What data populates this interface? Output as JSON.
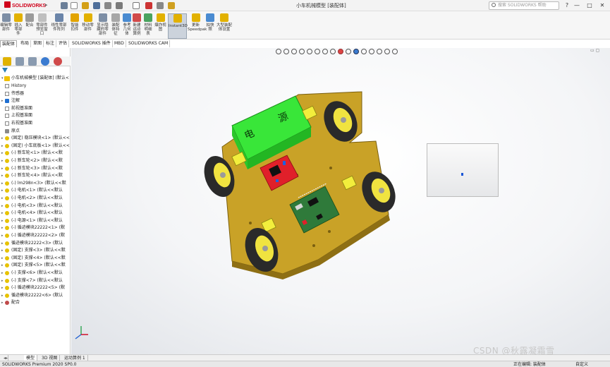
{
  "app": {
    "logo": "SOLIDWORKS",
    "doc_title": "小车机械模型 [装配体]",
    "search_placeholder": "搜索 SOLIDWORKS 帮助",
    "window_buttons": [
      "?",
      "—",
      "□",
      "✕"
    ]
  },
  "ribbon": {
    "buttons": [
      {
        "label": "编辑零部件",
        "color": "#7d8ea5"
      },
      {
        "label": "插入零部件",
        "color": "#e2b100"
      },
      {
        "label": "配合",
        "color": "#9b9b9b"
      },
      {
        "label": "零部件预览窗口",
        "color": "#bfbfbf"
      },
      {
        "label": "线性零部件阵列",
        "color": "#6b85a9"
      },
      {
        "label": "智能扣件",
        "color": "#e2a400"
      },
      {
        "label": "移动零部件",
        "color": "#e2b100"
      },
      {
        "label": "显示隐藏的零部件",
        "color": "#7d8ea5"
      },
      {
        "label": "装配体特征",
        "color": "#a7a7a7"
      },
      {
        "label": "参考几何体",
        "color": "#4a8bd1"
      },
      {
        "label": "新建运动算例",
        "color": "#d14a4a"
      },
      {
        "label": "材料明细表",
        "color": "#4aa35f"
      },
      {
        "label": "爆炸视图",
        "color": "#e2b100"
      },
      {
        "label": "Instant3D",
        "color": "#e2b100"
      },
      {
        "label": "更新 Speedpak",
        "color": "#e2b100"
      },
      {
        "label": "拍快照",
        "color": "#4a8bd1"
      },
      {
        "label": "大型装配体设置",
        "color": "#e2b100"
      }
    ]
  },
  "command_tabs": [
    "装配体",
    "布局",
    "草图",
    "标注",
    "评估",
    "SOLIDWORKS 插件",
    "MBD",
    "SOLIDWORKS CAM"
  ],
  "tree": {
    "root": "小车机械模型 [装配体] (默认<",
    "items": [
      {
        "label": "History",
        "icon": "history-icon",
        "kind": "doc"
      },
      {
        "label": "传感器",
        "icon": "sensor-icon",
        "kind": "doc"
      },
      {
        "label": "注解",
        "icon": "annotation-icon",
        "kind": "blue"
      },
      {
        "label": "前视基准面",
        "icon": "plane-icon",
        "kind": "doc"
      },
      {
        "label": "上视基准面",
        "icon": "plane-icon",
        "kind": "doc"
      },
      {
        "label": "右视基准面",
        "icon": "plane-icon",
        "kind": "doc"
      },
      {
        "label": "原点",
        "icon": "origin-icon",
        "kind": "gray"
      },
      {
        "label": "(固定) 稳压模块<1> (默认<<",
        "icon": "part-icon",
        "kind": "part"
      },
      {
        "label": "(固定) 小车底板<1> (默认<<",
        "icon": "part-icon",
        "kind": "part"
      },
      {
        "label": "(-) 新车轮<1> (默认<<默",
        "icon": "part-icon",
        "kind": "part"
      },
      {
        "label": "(-) 新车轮<2> (默认<<默",
        "icon": "part-icon",
        "kind": "part"
      },
      {
        "label": "(-) 新车轮<3> (默认<<默",
        "icon": "part-icon",
        "kind": "part"
      },
      {
        "label": "(-) 新车轮<4> (默认<<默",
        "icon": "part-icon",
        "kind": "part"
      },
      {
        "label": "(-) lm298n<3> (默认<<默",
        "icon": "part-icon",
        "kind": "part"
      },
      {
        "label": "(-) 电机<1> (默认<<默认",
        "icon": "part-icon",
        "kind": "part"
      },
      {
        "label": "(-) 电机<2> (默认<<默认",
        "icon": "part-icon",
        "kind": "part"
      },
      {
        "label": "(-) 电机<3> (默认<<默认",
        "icon": "part-icon",
        "kind": "part"
      },
      {
        "label": "(-) 电机<4> (默认<<默认",
        "icon": "part-icon",
        "kind": "part"
      },
      {
        "label": "(-) 电源<1> (默认<<默认",
        "icon": "part-icon",
        "kind": "part"
      },
      {
        "label": "(-) 循迹模块22222<1> (默",
        "icon": "part-icon",
        "kind": "part"
      },
      {
        "label": "(-) 循迹模块22222<2> (默",
        "icon": "part-icon",
        "kind": "part"
      },
      {
        "label": "循迹模块22222<3> (默认",
        "icon": "part-icon",
        "kind": "part"
      },
      {
        "label": "(固定) 支撑<3> (默认<<默",
        "icon": "part-icon",
        "kind": "part"
      },
      {
        "label": "(固定) 支撑<4> (默认<<默",
        "icon": "part-icon",
        "kind": "part"
      },
      {
        "label": "(固定) 支撑<5> (默认<<默",
        "icon": "part-icon",
        "kind": "part"
      },
      {
        "label": "(-) 支撑<6> (默认<<默认",
        "icon": "part-icon",
        "kind": "part"
      },
      {
        "label": "(-) 支撑<7> (默认<<默认",
        "icon": "part-icon",
        "kind": "part"
      },
      {
        "label": "(-) 循迹模块22222<5> (默",
        "icon": "part-icon",
        "kind": "part"
      },
      {
        "label": "循迹模块22222<6> (默认",
        "icon": "part-icon",
        "kind": "part"
      },
      {
        "label": "配合",
        "icon": "mate-icon",
        "kind": "mate"
      }
    ]
  },
  "model": {
    "battery_label_1": "电",
    "battery_label_2": "源"
  },
  "bottom_tabs": [
    "模型",
    "3D 视图",
    "运动算例 1"
  ],
  "status": {
    "left": "SOLIDWORKS Premium 2020 SP0.0",
    "right_items": [
      "正在编辑: 装配体",
      "自定义"
    ]
  },
  "watermark": "CSDN @秋露凝霜雪",
  "colors": {
    "body_yellow": "#c9a227",
    "battery_green": "#39e639",
    "driver_red": "#e0202a",
    "board_green": "#2f7a3a",
    "wheel_dark": "#2a2a2a",
    "accent_red": "#d0021b"
  }
}
